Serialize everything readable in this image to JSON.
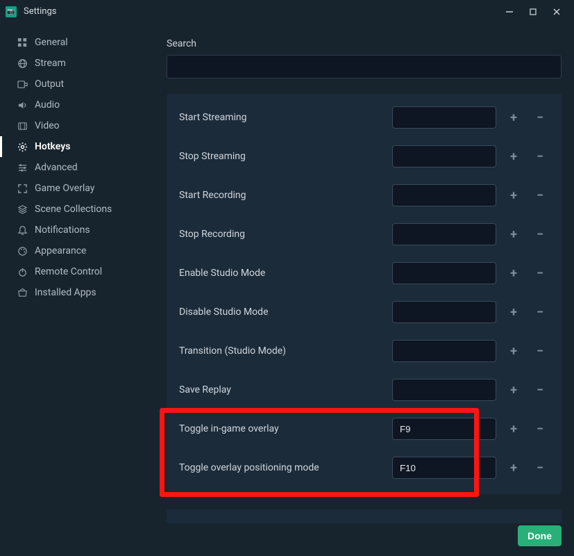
{
  "titlebar": {
    "title": "Settings"
  },
  "sidebar": {
    "items": [
      {
        "label": "General",
        "icon": "grid"
      },
      {
        "label": "Stream",
        "icon": "globe"
      },
      {
        "label": "Output",
        "icon": "output"
      },
      {
        "label": "Audio",
        "icon": "speaker"
      },
      {
        "label": "Video",
        "icon": "film"
      },
      {
        "label": "Hotkeys",
        "icon": "gear",
        "active": true
      },
      {
        "label": "Advanced",
        "icon": "sliders"
      },
      {
        "label": "Game Overlay",
        "icon": "expand"
      },
      {
        "label": "Scene Collections",
        "icon": "stack"
      },
      {
        "label": "Notifications",
        "icon": "bell"
      },
      {
        "label": "Appearance",
        "icon": "palette"
      },
      {
        "label": "Remote Control",
        "icon": "power"
      },
      {
        "label": "Installed Apps",
        "icon": "store"
      }
    ]
  },
  "search": {
    "label": "Search",
    "value": ""
  },
  "hotkeys": [
    {
      "label": "Start Streaming",
      "value": ""
    },
    {
      "label": "Stop Streaming",
      "value": ""
    },
    {
      "label": "Start Recording",
      "value": ""
    },
    {
      "label": "Stop Recording",
      "value": ""
    },
    {
      "label": "Enable Studio Mode",
      "value": ""
    },
    {
      "label": "Disable Studio Mode",
      "value": ""
    },
    {
      "label": "Transition (Studio Mode)",
      "value": ""
    },
    {
      "label": "Save Replay",
      "value": ""
    },
    {
      "label": "Toggle in-game overlay",
      "value": "F9",
      "highlighted": true
    },
    {
      "label": "Toggle overlay positioning mode",
      "value": "F10",
      "highlighted": true
    }
  ],
  "buttons": {
    "done": "Done"
  },
  "colors": {
    "accent": "#29b079",
    "highlight": "#ff1414"
  }
}
